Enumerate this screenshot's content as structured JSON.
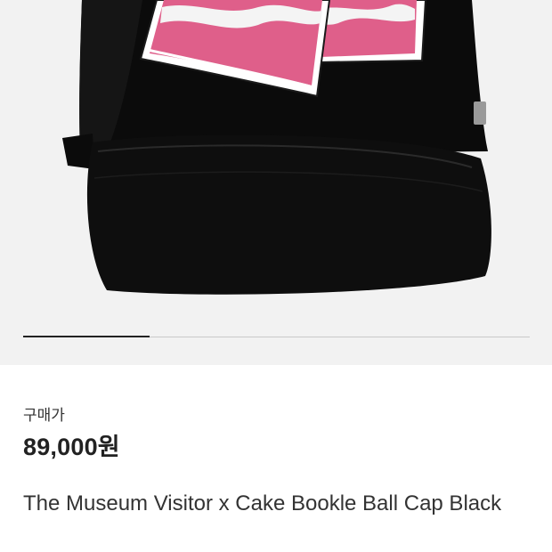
{
  "product_image": {
    "alt_icon": "baseball-cap-with-pink-cake-patch",
    "colors": {
      "background": "#f2f2f2",
      "cap": "#0b0b0b",
      "patch_pink": "#df5f8a",
      "patch_white": "#f4f4f4"
    }
  },
  "carousel": {
    "active_fraction": 0.25
  },
  "product": {
    "price_label": "구매가",
    "price": "89,000원",
    "name": "The Museum Visitor x Cake Bookle Ball Cap Black"
  }
}
